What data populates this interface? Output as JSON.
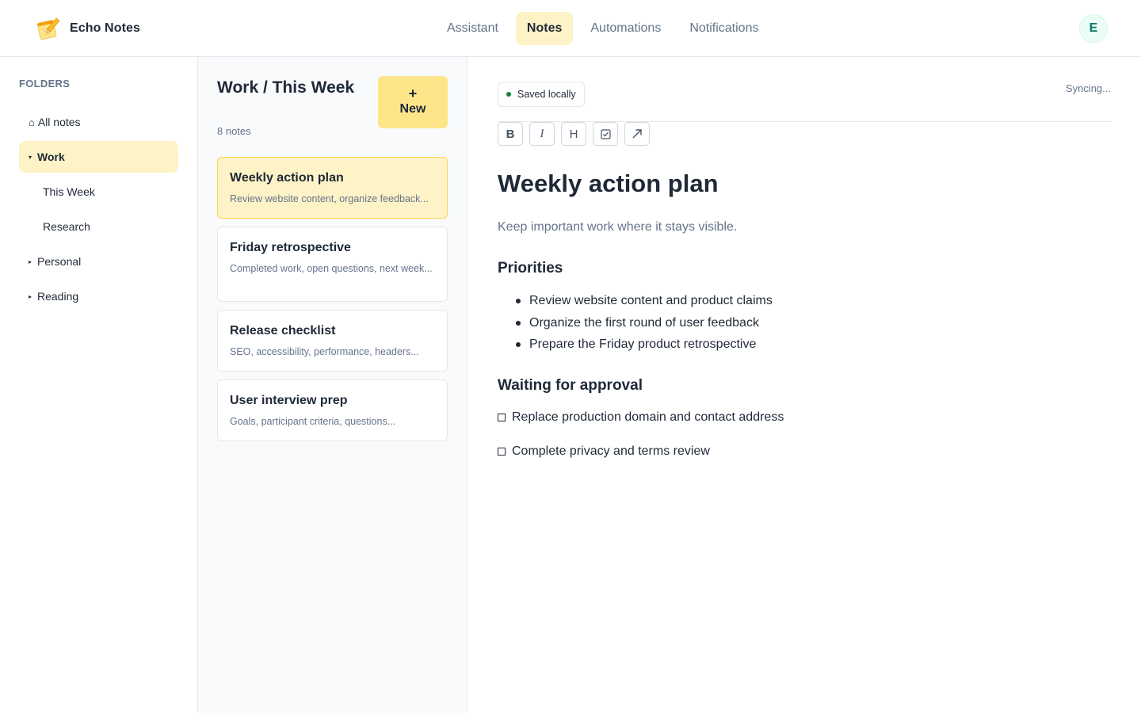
{
  "app": {
    "name": "Echo Notes",
    "logo_icon": "notepad-pencil-icon"
  },
  "nav": {
    "tabs": [
      {
        "label": "Assistant",
        "active": false
      },
      {
        "label": "Notes",
        "active": true
      },
      {
        "label": "Automations",
        "active": false
      },
      {
        "label": "Notifications",
        "active": false
      }
    ]
  },
  "user": {
    "avatar_initial": "E"
  },
  "sidebar": {
    "heading": "FOLDERS",
    "items": [
      {
        "label": "All notes",
        "icon": "home-icon",
        "glyph": "⌂",
        "active": false
      },
      {
        "label": "Work",
        "icon": "caret-down-icon",
        "glyph": "▾",
        "active": true
      },
      {
        "label": "This Week",
        "child": true
      },
      {
        "label": "Research",
        "child": true
      },
      {
        "label": "Personal",
        "icon": "caret-right-icon",
        "glyph": "▸",
        "active": false
      },
      {
        "label": "Reading",
        "icon": "caret-right-icon",
        "glyph": "▸",
        "active": false
      }
    ]
  },
  "notelist": {
    "title": "Work / This Week",
    "count": "8 notes",
    "new_button": {
      "plus": "+",
      "label": "New"
    },
    "notes": [
      {
        "title": "Weekly action plan",
        "snippet": "Review website content, organize feedback...",
        "active": true
      },
      {
        "title": "Friday retrospective",
        "snippet": "Completed work, open questions, next week...",
        "active": false
      },
      {
        "title": "Release checklist",
        "snippet": "SEO, accessibility, performance, headers...",
        "active": false
      },
      {
        "title": "User interview prep",
        "snippet": "Goals, participant criteria, questions...",
        "active": false
      }
    ]
  },
  "editor": {
    "saved_status": "Saved locally",
    "sync_status": "Syncing...",
    "toolbar": [
      {
        "label": "B",
        "name": "bold-button"
      },
      {
        "label": "I",
        "name": "italic-button"
      },
      {
        "label": "H",
        "name": "heading-button"
      },
      {
        "icon": "checkbox-icon",
        "name": "checklist-button"
      },
      {
        "icon": "arrow-up-right-icon",
        "name": "link-button"
      }
    ],
    "title": "Weekly action plan",
    "subtitle": "Keep important work where it stays visible.",
    "sections": [
      {
        "heading": "Priorities",
        "items": [
          "Review website content and product claims",
          "Organize the first round of user feedback",
          "Prepare the Friday product retrospective"
        ]
      },
      {
        "heading": "Waiting for approval",
        "checklist": [
          {
            "label": "Replace production domain and contact address",
            "checked": false
          },
          {
            "label": "Complete privacy and terms review",
            "checked": false
          }
        ]
      }
    ]
  },
  "colors": {
    "accent": "#fef3c7",
    "new_button": "#fde68a",
    "active_border": "#fcd34d",
    "status_dot": "#15803d",
    "muted_text": "#64748b"
  }
}
